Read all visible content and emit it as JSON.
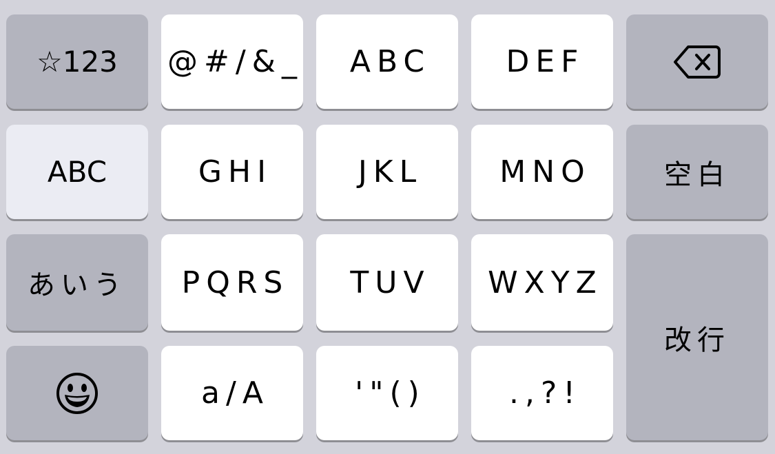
{
  "keyboard": {
    "row0": {
      "mode_numbers": "☆123",
      "symbols": "@#/&_",
      "abc": "ABC",
      "def": "DEF",
      "backspace_icon": "backspace-icon"
    },
    "row1": {
      "mode_alpha": "ABC",
      "ghi": "GHI",
      "jkl": "JKL",
      "mno": "MNO",
      "space": "空白"
    },
    "row2": {
      "mode_kana": "あいう",
      "pqrs": "PQRS",
      "tuv": "TUV",
      "wxyz": "WXYZ",
      "return": "改行"
    },
    "row3": {
      "emoji_icon": "smiley-icon",
      "case_toggle": "a/A",
      "quotes_parens": "'\"()",
      "punctuation": ".,?!"
    },
    "colors": {
      "background": "#d3d3db",
      "letter_key": "#ffffff",
      "function_key": "#b3b4be",
      "active_mode_key": "#ebecf3"
    }
  }
}
